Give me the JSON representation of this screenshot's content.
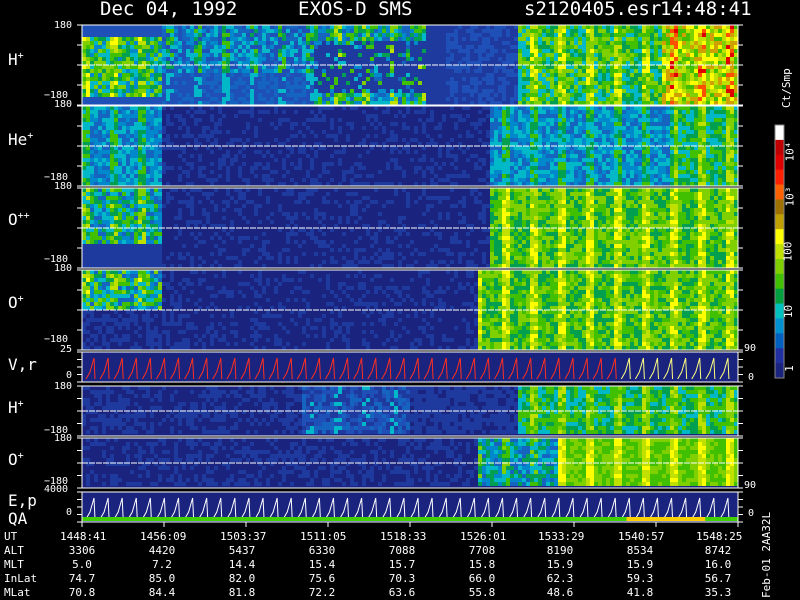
{
  "header": {
    "date": "Dec 04, 1992",
    "instrument": "EXOS-D SMS",
    "file": "s2120405.esr",
    "time": "14:48:41"
  },
  "panels": [
    {
      "label_main": "H",
      "label_sup": "+",
      "top_tick": "180",
      "bottom_tick": "−180"
    },
    {
      "label_main": "He",
      "label_sup": "+",
      "top_tick": "180",
      "bottom_tick": "−180"
    },
    {
      "label_main": "O",
      "label_sup": "++",
      "top_tick": "180",
      "bottom_tick": "−180"
    },
    {
      "label_main": "O",
      "label_sup": "+",
      "top_tick": "180",
      "bottom_tick": "−180"
    },
    {
      "label_main": "V,r",
      "label_sup": "",
      "top_tick": "25",
      "bottom_tick": "0",
      "right_top_tick": "90",
      "right_bottom_tick": "0"
    },
    {
      "label_main": "H",
      "label_sup": "+",
      "top_tick": "180",
      "bottom_tick": "−180"
    },
    {
      "label_main": "O",
      "label_sup": "+",
      "top_tick": "180",
      "bottom_tick": "−180"
    },
    {
      "label_main": "E,p",
      "label_sup": "",
      "label2": "QA",
      "top_tick": "4000",
      "bottom_tick": "0",
      "right_top_tick": "90",
      "right_bottom_tick": "0"
    }
  ],
  "colorbar": {
    "unit": "Ct/Smp",
    "ticks": [
      "10⁴",
      "10³",
      "100",
      "10",
      "1"
    ],
    "colors": [
      "#ffffff",
      "#c00000",
      "#e00000",
      "#ff2000",
      "#ff6000",
      "#a07000",
      "#c0a000",
      "#ffff00",
      "#c0e000",
      "#80d000",
      "#40c000",
      "#00a040",
      "#00c0c0",
      "#0090d0",
      "#0060c0",
      "#2030a0",
      "#1a237e"
    ]
  },
  "footer": {
    "row_labels": [
      "UT",
      "ALT",
      "MLT",
      "InLat",
      "MLat"
    ],
    "columns": [
      {
        "UT": "1448:41",
        "ALT": "3306",
        "MLT": "5.0",
        "InLat": "74.7",
        "MLat": "70.8"
      },
      {
        "UT": "1456:09",
        "ALT": "4420",
        "MLT": "7.2",
        "InLat": "85.0",
        "MLat": "84.4"
      },
      {
        "UT": "1503:37",
        "ALT": "5437",
        "MLT": "14.4",
        "InLat": "82.0",
        "MLat": "81.8"
      },
      {
        "UT": "1511:05",
        "ALT": "6330",
        "MLT": "15.4",
        "InLat": "75.6",
        "MLat": "72.2"
      },
      {
        "UT": "1518:33",
        "ALT": "7088",
        "MLT": "15.7",
        "InLat": "70.3",
        "MLat": "63.6"
      },
      {
        "UT": "1526:01",
        "ALT": "7708",
        "MLT": "15.8",
        "InLat": "66.0",
        "MLat": "55.8"
      },
      {
        "UT": "1533:29",
        "ALT": "8190",
        "MLT": "15.9",
        "InLat": "62.3",
        "MLat": "48.6"
      },
      {
        "UT": "1540:57",
        "ALT": "8534",
        "MLT": "15.9",
        "InLat": "59.3",
        "MLat": "41.8"
      },
      {
        "UT": "1548:25",
        "ALT": "8742",
        "MLT": "16.0",
        "InLat": "56.7",
        "MLat": "35.3"
      }
    ],
    "side_label": "Feb-01 2AA32L"
  },
  "chart_data": {
    "type": "heatmap",
    "title": "Dec 04, 1992   EXOS-D SMS",
    "xlabel": "UT",
    "x_ticks": [
      "1448:41",
      "1456:09",
      "1503:37",
      "1511:05",
      "1518:33",
      "1526:01",
      "1533:29",
      "1540:57",
      "1548:25"
    ],
    "ylim": [
      -180,
      180
    ],
    "colorbar_unit": "Ct/Smp",
    "colorbar_ticks": [
      "1",
      "10",
      "100",
      "10³",
      "10⁴"
    ],
    "series": [
      {
        "name": "H+"
      },
      {
        "name": "He+"
      },
      {
        "name": "O++"
      },
      {
        "name": "O+"
      },
      {
        "name": "V,r"
      },
      {
        "name": "H+"
      },
      {
        "name": "O+"
      },
      {
        "name": "E,p"
      }
    ]
  }
}
